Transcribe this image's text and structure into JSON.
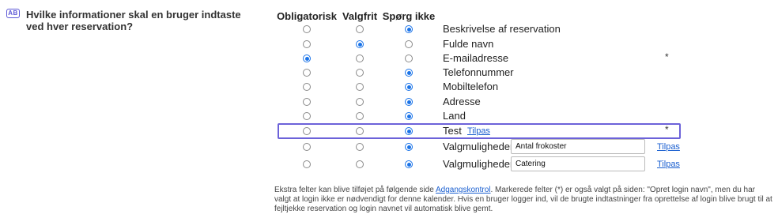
{
  "question": {
    "icon_text": "AB",
    "title": "Hvilke informationer skal en bruger indtaste ved hver reservation?"
  },
  "columns": [
    "Obligatorisk",
    "Valgfrit",
    "Spørg ikke"
  ],
  "rows": [
    {
      "label": "Beskrivelse af reservation",
      "selected": 2
    },
    {
      "label": "Fulde navn",
      "selected": 1
    },
    {
      "label": "E-mailadresse",
      "selected": 0,
      "star": "*"
    },
    {
      "label": "Telefonnummer",
      "selected": 2
    },
    {
      "label": "Mobiltelefon",
      "selected": 2
    },
    {
      "label": "Adresse",
      "selected": 2
    },
    {
      "label": "Land",
      "selected": 2
    },
    {
      "label": "Test",
      "selected": 2,
      "inline_link": "Tilpas",
      "star": "*"
    },
    {
      "label": "Valgmuligheder:",
      "selected": 2,
      "input_value": "Antal frokoster",
      "right_link": "Tilpas"
    },
    {
      "label": "Valgmuligheder:",
      "selected": 2,
      "input_value": "Catering",
      "right_link": "Tilpas"
    }
  ],
  "footer": {
    "text_before": "Ekstra felter kan blive tilføjet på følgende side ",
    "link": "Adgangskontrol",
    "text_after": ". Markerede felter (*) er også valgt på siden: \"Opret login navn\", men du har valgt at login ikke er nødvendigt for denne kalender. Hvis en bruger logger ind, vil de brugte indtastninger fra oprettelse af login blive brugt til at fejltjekke reservation og login navnet vil automatisk blive gemt."
  }
}
